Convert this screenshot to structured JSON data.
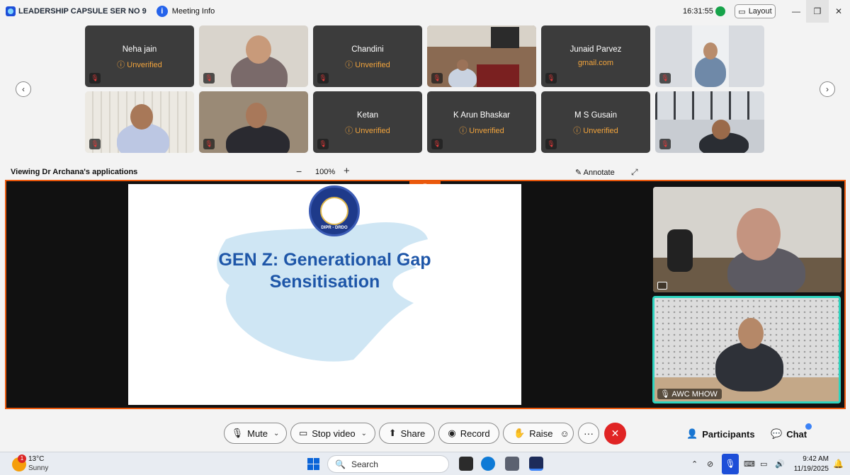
{
  "window": {
    "meeting_title": "LEADERSHIP CAPSULE SER NO 9",
    "meeting_info": "Meeting Info",
    "time": "16:31:55",
    "layout_label": "Layout"
  },
  "participants": [
    {
      "name": "Neha jain",
      "status": "Unverified",
      "muted": true,
      "video": false
    },
    {
      "name": "",
      "status": "",
      "muted": true,
      "video": true
    },
    {
      "name": "Chandini",
      "status": "Unverified",
      "muted": true,
      "video": false
    },
    {
      "name": "",
      "status": "",
      "muted": true,
      "video": true
    },
    {
      "name": "Junaid Parvez",
      "status": "gmail.com",
      "muted": true,
      "video": false
    },
    {
      "name": "",
      "status": "",
      "muted": true,
      "video": true
    },
    {
      "name": "",
      "status": "",
      "muted": true,
      "video": true
    },
    {
      "name": "",
      "status": "",
      "muted": true,
      "video": true
    },
    {
      "name": "Ketan",
      "status": "Unverified",
      "muted": true,
      "video": false
    },
    {
      "name": "K Arun Bhaskar",
      "status": "Unverified",
      "muted": true,
      "video": false
    },
    {
      "name": "M S Gusain",
      "status": "Unverified",
      "muted": true,
      "video": false
    },
    {
      "name": "",
      "status": "",
      "muted": true,
      "video": true
    }
  ],
  "share": {
    "viewing_text": "Viewing Dr Archana's applications",
    "zoom": "100%",
    "annotate_label": "Annotate",
    "slide_title_line1": "GEN Z: Generational Gap",
    "slide_title_line2": "Sensitisation",
    "emblem_text": "DIPR - DRDO"
  },
  "videos": {
    "presenter_label": "",
    "self_label": "AWC MHOW"
  },
  "controls": {
    "mute": "Mute",
    "stop_video": "Stop video",
    "share": "Share",
    "record": "Record",
    "raise": "Raise",
    "participants": "Participants",
    "chat": "Chat"
  },
  "taskbar": {
    "weather_temp": "13°C",
    "weather_desc": "Sunny",
    "weather_badge": "1",
    "search_placeholder": "Search",
    "time": "9:42 AM",
    "date": "11/19/2025"
  },
  "colors": {
    "accent_orange": "#ea580c",
    "unverified": "#f2a43c",
    "end_call": "#e02424",
    "self_border": "#2dd4bf",
    "slide_title": "#1e56a8"
  }
}
